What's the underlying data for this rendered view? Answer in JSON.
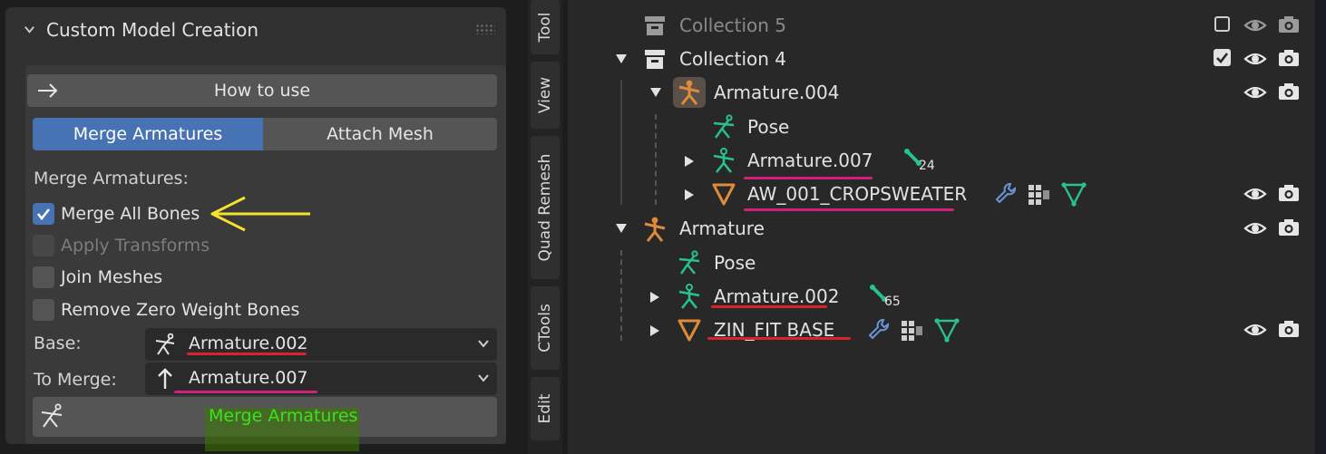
{
  "panel": {
    "title": "Custom Model Creation",
    "how_to_use": "How to use",
    "tabs": [
      "Merge Armatures",
      "Attach Mesh"
    ],
    "active_tab": "Merge Armatures",
    "section_label": "Merge Armatures:",
    "options": [
      {
        "label": "Merge All Bones",
        "checked": true,
        "enabled": true
      },
      {
        "label": "Apply Transforms",
        "checked": false,
        "enabled": false
      },
      {
        "label": "Join Meshes",
        "checked": false,
        "enabled": true
      },
      {
        "label": "Remove Zero Weight Bones",
        "checked": false,
        "enabled": true
      }
    ],
    "base_label": "Base:",
    "base_value": "Armature.002",
    "to_merge_label": "To Merge:",
    "to_merge_value": "Armature.007",
    "merge_button": "Merge Armatures"
  },
  "side_tabs": [
    "Tool",
    "View",
    "Quad Remesh",
    "CTools",
    "Edit"
  ],
  "outliner": {
    "rows": [
      {
        "label": "Collection 5",
        "icon": "collection-icon",
        "dim": true,
        "checkbox": false
      },
      {
        "label": "Collection 4",
        "icon": "collection-icon",
        "checkbox": true
      },
      {
        "label": "Armature.004",
        "icon": "armature-icon"
      },
      {
        "label": "Pose",
        "icon": "pose-icon"
      },
      {
        "label": "Armature.007",
        "icon": "armature-data-icon",
        "bone_count": "24"
      },
      {
        "label": "AW_001_CROPSWEATER",
        "icon": "mesh-icon"
      },
      {
        "label": "Armature",
        "icon": "armature-icon"
      },
      {
        "label": "Pose",
        "icon": "pose-icon"
      },
      {
        "label": "Armature.002",
        "icon": "armature-data-icon",
        "bone_count": "65"
      },
      {
        "label": "ZIN_FIT BASE",
        "icon": "mesh-icon"
      }
    ]
  },
  "colors": {
    "accent_blue": "#4772b3",
    "armature_orange": "#e08a3c",
    "data_green": "#27c28f",
    "annotation_red": "#d8232e",
    "annotation_yellow": "#f5e22c",
    "highlight_green": "#3ce21c"
  }
}
